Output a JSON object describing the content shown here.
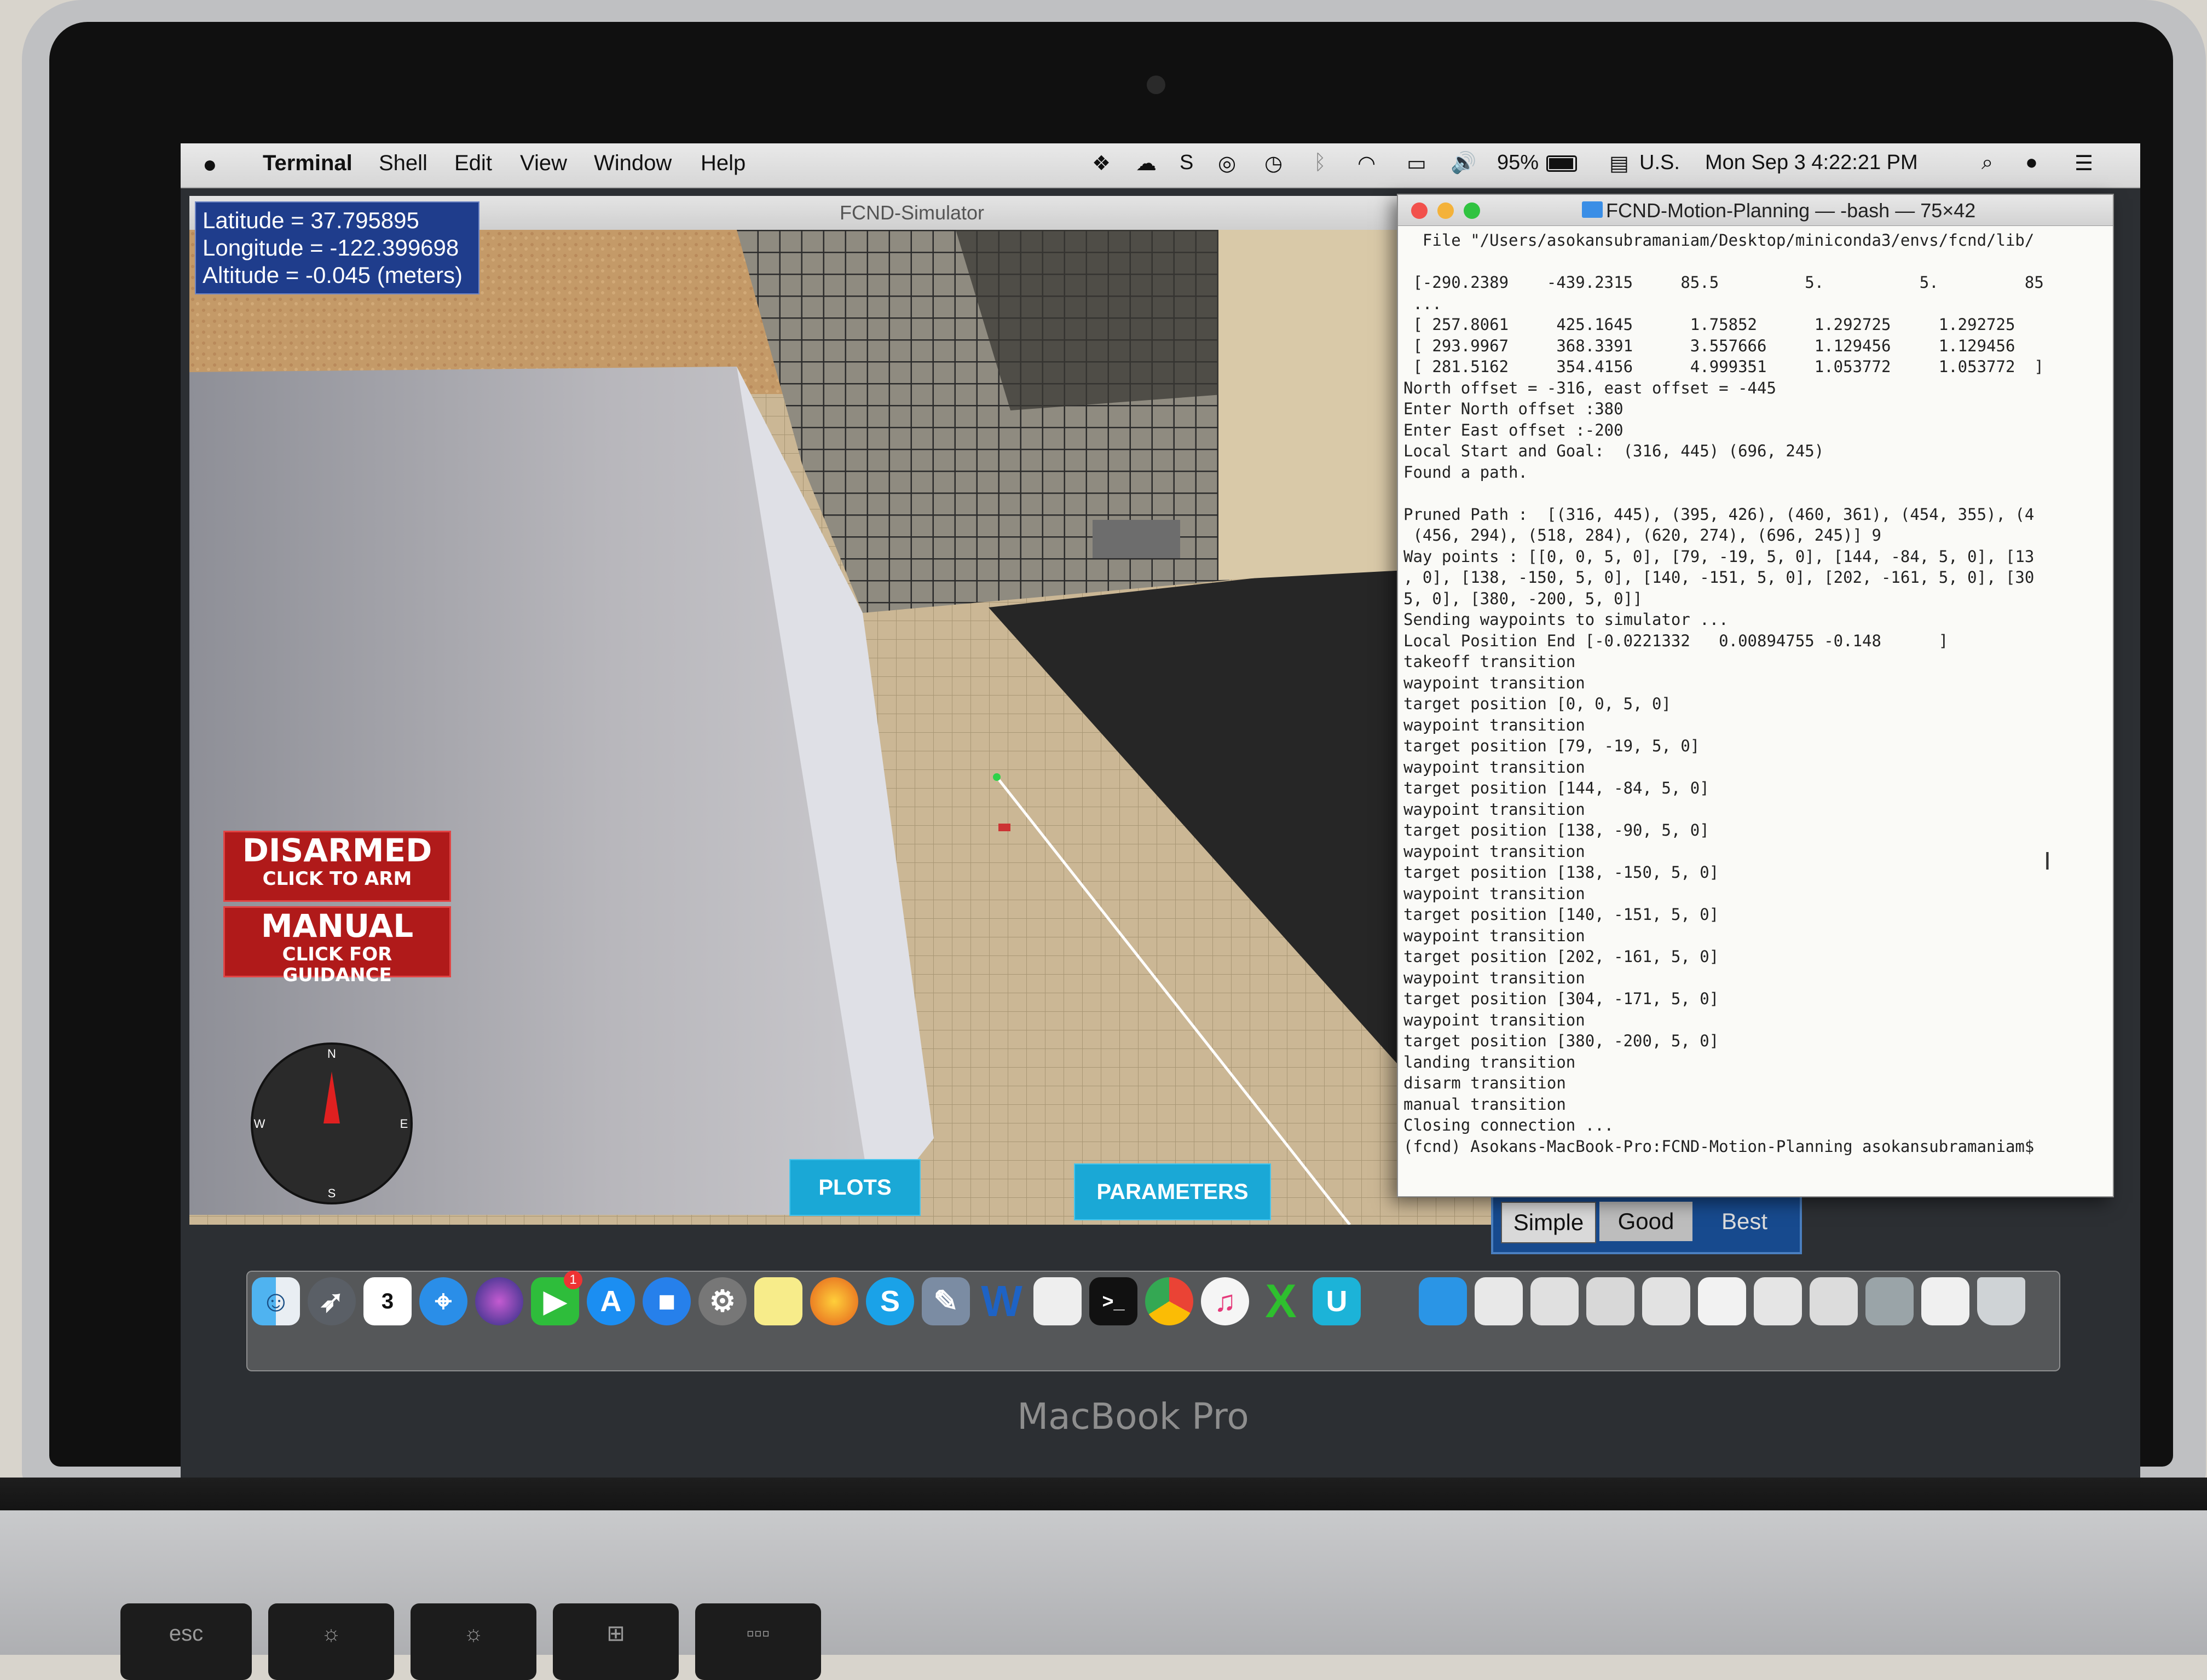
{
  "laptop": {
    "model_label": "MacBook Pro",
    "keys": [
      "esc",
      "☼",
      "☼",
      "⊞",
      "▫▫▫"
    ]
  },
  "menubar": {
    "app": "Terminal",
    "items": [
      "Shell",
      "Edit",
      "View",
      "Window",
      "Help"
    ],
    "battery": "95%",
    "input_source": "U.S.",
    "clock": "Mon Sep 3  4:22:21 PM"
  },
  "simulator": {
    "title": "FCND-Simulator",
    "latitude": "Latitude = 37.795895",
    "longitude": "Longitude = -122.399698",
    "altitude": "Altitude = -0.045 (meters)",
    "arm_status": "DISARMED",
    "arm_hint": "CLICK TO ARM",
    "mode_status": "MANUAL",
    "mode_hint": "CLICK FOR GUIDANCE",
    "compass": {
      "n": "N",
      "s": "S",
      "e": "E",
      "w": "W"
    },
    "plots_button": "PLOTS",
    "parameters_button": "PARAMETERS"
  },
  "quality": {
    "options": [
      "Simple",
      "Good",
      "Best"
    ],
    "selected": "Good"
  },
  "terminal": {
    "title": "FCND-Motion-Planning — -bash — 75×42",
    "lines": [
      "  File \"/Users/asokansubramaniam/Desktop/miniconda3/envs/fcnd/lib/",
      "",
      " [-290.2389    -439.2315     85.5         5.          5.         85",
      " ...",
      " [ 257.8061     425.1645      1.75852      1.292725     1.292725   ",
      " [ 293.9967     368.3391      3.557666     1.129456     1.129456   ",
      " [ 281.5162     354.4156      4.999351     1.053772     1.053772  ]",
      "North offset = -316, east offset = -445",
      "Enter North offset :380",
      "Enter East offset :-200",
      "Local Start and Goal:  (316, 445) (696, 245)",
      "Found a path.",
      "",
      "Pruned Path :  [(316, 445), (395, 426), (460, 361), (454, 355), (4",
      " (456, 294), (518, 284), (620, 274), (696, 245)] 9",
      "Way points : [[0, 0, 5, 0], [79, -19, 5, 0], [144, -84, 5, 0], [13",
      ", 0], [138, -150, 5, 0], [140, -151, 5, 0], [202, -161, 5, 0], [30",
      "5, 0], [380, -200, 5, 0]]",
      "Sending waypoints to simulator ...",
      "Local Position End [-0.0221332   0.00894755 -0.148      ]",
      "takeoff transition",
      "waypoint transition",
      "target position [0, 0, 5, 0]",
      "waypoint transition",
      "target position [79, -19, 5, 0]",
      "waypoint transition",
      "target position [144, -84, 5, 0]",
      "waypoint transition",
      "target position [138, -90, 5, 0]",
      "waypoint transition",
      "target position [138, -150, 5, 0]",
      "waypoint transition",
      "target position [140, -151, 5, 0]",
      "waypoint transition",
      "target position [202, -161, 5, 0]",
      "waypoint transition",
      "target position [304, -171, 5, 0]",
      "waypoint transition",
      "target position [380, -200, 5, 0]",
      "landing transition",
      "disarm transition",
      "manual transition",
      "Closing connection ...",
      "(fcnd) Asokans-MacBook-Pro:FCND-Motion-Planning asokansubramaniam$"
    ]
  },
  "dock": {
    "calendar_day": "3",
    "facetime_badge": "1",
    "skype_letter": "S",
    "word_letter": "W",
    "excel_letter": "X",
    "u_letter": "U"
  },
  "colors": {
    "arm_red": "#b01a1a",
    "gps_blue": "#1f3d8c",
    "button_cyan": "#1aa8d6"
  }
}
